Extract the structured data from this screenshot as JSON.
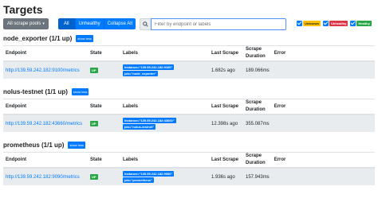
{
  "page": {
    "title": "Targets"
  },
  "filters": {
    "scrape_pools_label": "All scrape pools",
    "all_label": "All",
    "unhealthy_label": "Unhealthy",
    "collapse_all_label": "Collapse All",
    "search_placeholder": "Filter by endpoint or labels",
    "health": [
      {
        "label": "Unknown",
        "color": "#ffc107",
        "text_color": "#212529",
        "checked": true
      },
      {
        "label": "Unhealthy",
        "color": "#dc3545",
        "text_color": "#ffffff",
        "checked": true
      },
      {
        "label": "Healthy",
        "color": "#28a745",
        "text_color": "#ffffff",
        "checked": true
      }
    ]
  },
  "columns": {
    "endpoint": "Endpoint",
    "state": "State",
    "labels": "Labels",
    "last_scrape": "Last Scrape",
    "scrape_duration": "Scrape Duration",
    "error": "Error"
  },
  "pools": [
    {
      "title": "node_exporter (1/1 up)",
      "toggle_label": "show less",
      "target": {
        "endpoint": "http://139.59.242.182:9100/metrics",
        "state": "UP",
        "labels": [
          "instance=\"139.59.242.182:9100\"",
          "job=\"node_exporter\""
        ],
        "last_scrape": "1.682s ago",
        "scrape_duration": "189.066ms",
        "error": ""
      }
    },
    {
      "title": "nolus-testnet (1/1 up)",
      "toggle_label": "show less",
      "target": {
        "endpoint": "http://139.59.242.182:43660/metrics",
        "state": "UP",
        "labels": [
          "instance=\"139.59.242.182:43660\"",
          "job=\"nolus-testnet\""
        ],
        "last_scrape": "12.398s ago",
        "scrape_duration": "355.087ms",
        "error": ""
      }
    },
    {
      "title": "prometheus (1/1 up)",
      "toggle_label": "show less",
      "target": {
        "endpoint": "http://139.59.242.182:9090/metrics",
        "state": "UP",
        "labels": [
          "instance=\"139.59.242.182:9090\"",
          "job=\"prometheus\""
        ],
        "last_scrape": "1.936s ago",
        "scrape_duration": "157.943ms",
        "error": ""
      }
    }
  ],
  "colors": {
    "primary": "#007bff",
    "success": "#28a745",
    "row_bg": "#e9ecef"
  }
}
